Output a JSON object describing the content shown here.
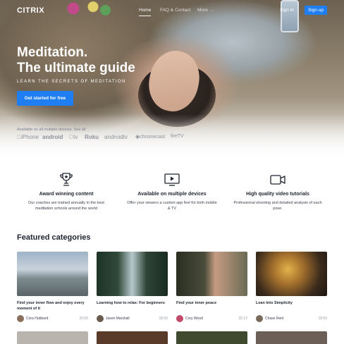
{
  "nav": {
    "logo": "CITRIX",
    "links": [
      "Home",
      "FAQ & Contact",
      "More"
    ],
    "signin": "Sign in",
    "signup": "Sign up"
  },
  "hero": {
    "title_line1": "Meditation.",
    "title_line2": "The ultimate guide",
    "subtitle": "LEARN THE SECRETS OF MEDITATION",
    "cta": "Get started for free",
    "devices_label": "Available on all multiple devices. See all",
    "platforms": [
      "iPhone",
      "android",
      "tv",
      "Roku",
      "androidtv",
      "chromecast",
      "fireTV"
    ]
  },
  "features": [
    {
      "icon": "award-trophy-icon",
      "title": "Award winning content",
      "desc": "Our coaches are trained annually in the best meditation schools around the world"
    },
    {
      "icon": "play-screen-icon",
      "title": "Available on multiple devices",
      "desc": "Offer your viewers a custom app feel for both mobile & TV"
    },
    {
      "icon": "video-camera-icon",
      "title": "High quality video tutorials",
      "desc": "Professional shooting and detailed analysis of each pose."
    }
  ],
  "featured": {
    "title": "Featured categories",
    "cards": [
      {
        "title": "Find your inner flow and enjoy every moment of it",
        "author": "Cora Hubbard",
        "duration": "20:00"
      },
      {
        "title": "Learning how to relax: For beginners",
        "author": "Jason Marshall",
        "duration": "18:50"
      },
      {
        "title": "Find your inner peace",
        "author": "Cory Wood",
        "duration": "32:12"
      },
      {
        "title": "Lean Into Simplicity",
        "author": "Chase Reid",
        "duration": "18:50"
      }
    ]
  },
  "colors": {
    "accent": "#1f7ef2",
    "text": "#1f2430",
    "muted": "#9aa0aa"
  }
}
